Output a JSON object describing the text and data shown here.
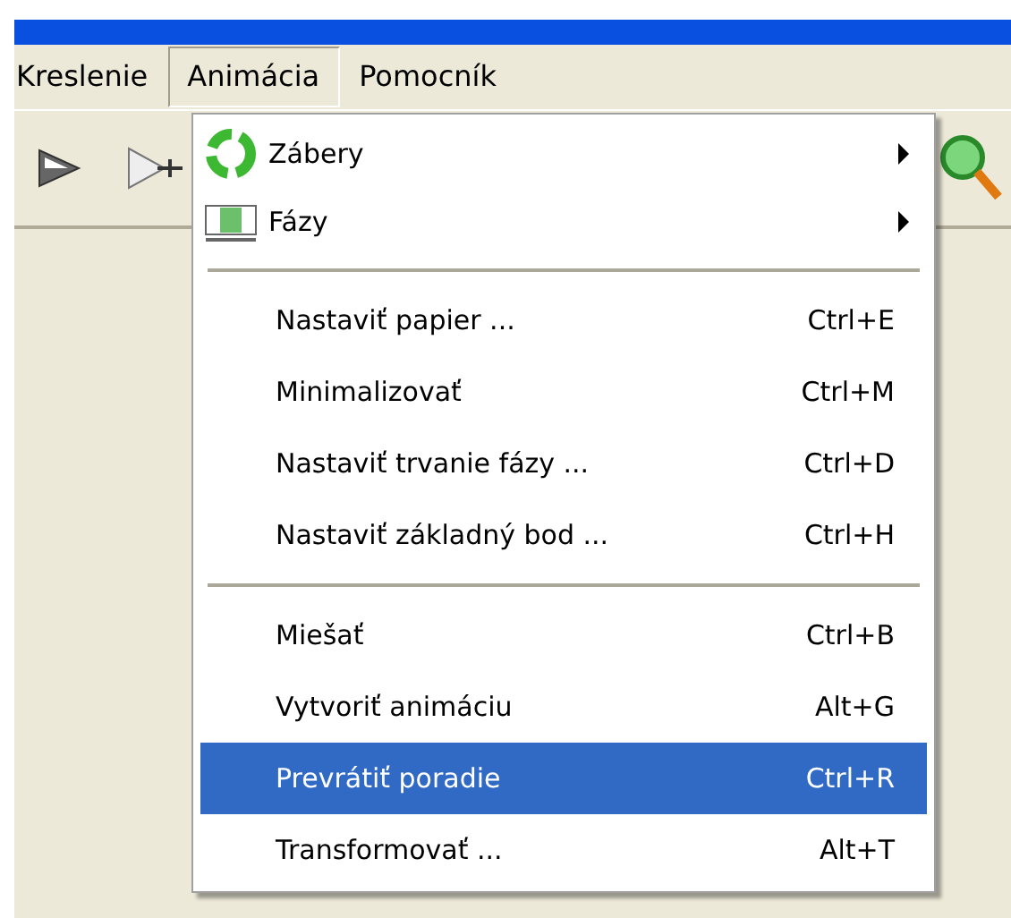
{
  "menu_bar": [
    {
      "label": "Kreslenie",
      "selected": false
    },
    {
      "label": "Animácia",
      "selected": true
    },
    {
      "label": "Pomocník",
      "selected": false
    }
  ],
  "menu": [
    {
      "kind": "submenu",
      "label": "Zábery",
      "selected": false
    },
    {
      "kind": "submenu",
      "label": "Fázy",
      "selected": false
    },
    {
      "kind": "separator"
    },
    {
      "kind": "command",
      "label": "Nastaviť papier ...",
      "shortcut": "Ctrl+E",
      "selected": false
    },
    {
      "kind": "command",
      "label": "Minimalizovať",
      "shortcut": "Ctrl+M",
      "selected": false
    },
    {
      "kind": "command",
      "label": "Nastaviť trvanie fázy ...",
      "shortcut": "Ctrl+D",
      "selected": false
    },
    {
      "kind": "command",
      "label": "Nastaviť základný bod ...",
      "shortcut": "Ctrl+H",
      "selected": false
    },
    {
      "kind": "separator"
    },
    {
      "kind": "command",
      "label": "Miešať",
      "shortcut": "Ctrl+B",
      "selected": false
    },
    {
      "kind": "command",
      "label": "Vytvoriť animáciu",
      "shortcut": "Alt+G",
      "selected": false
    },
    {
      "kind": "command",
      "label": "Prevrátiť poradie",
      "shortcut": "Ctrl+R",
      "selected": true
    },
    {
      "kind": "command",
      "label": "Transformovať ...",
      "shortcut": "Alt+T",
      "selected": false
    }
  ]
}
